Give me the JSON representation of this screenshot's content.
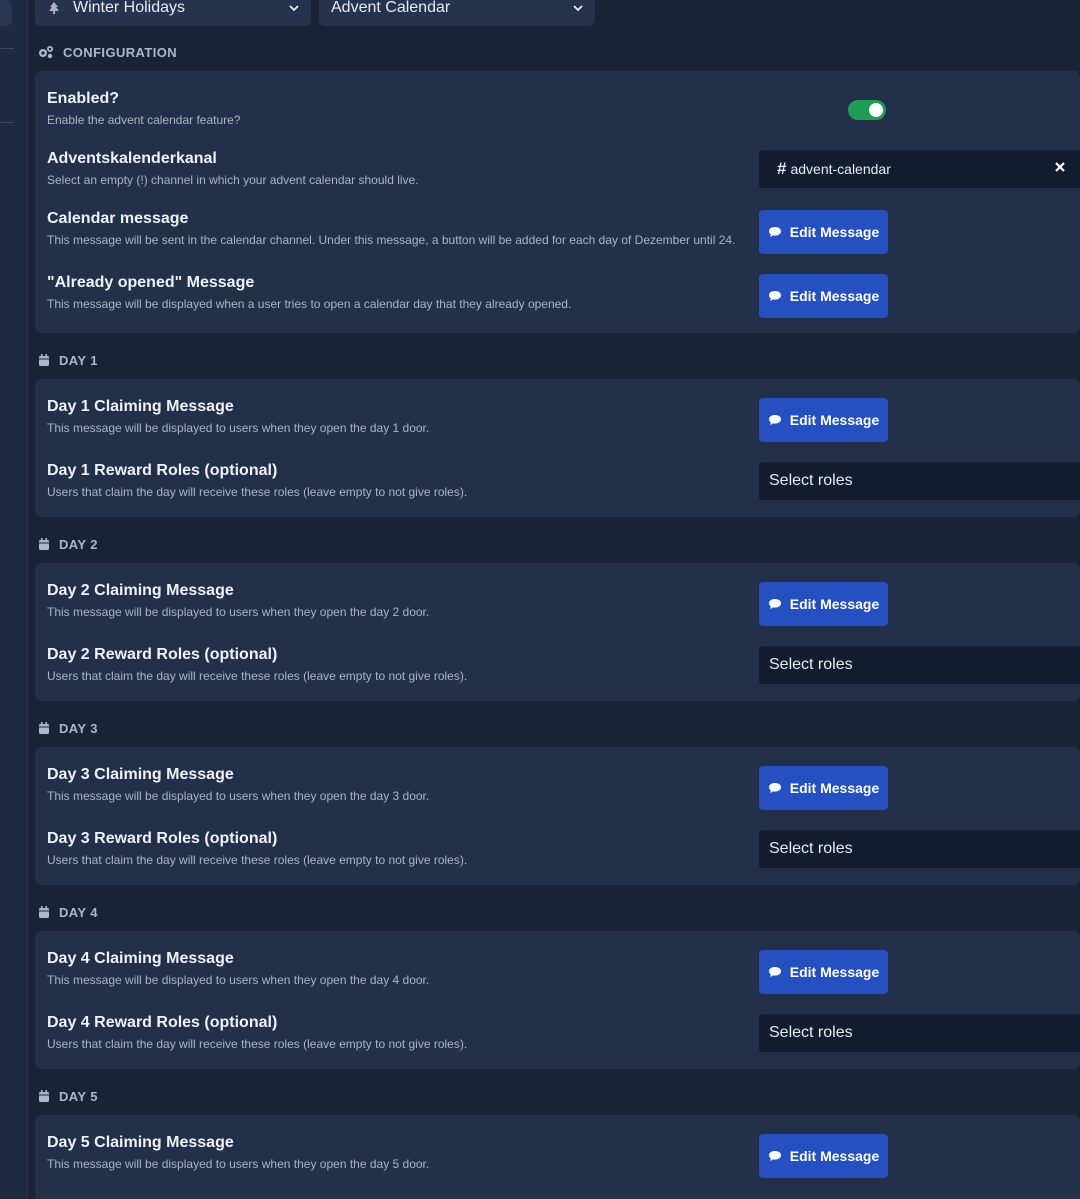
{
  "top": {
    "category_select": "Winter Holidays",
    "module_select": "Advent Calendar"
  },
  "configuration": {
    "header": "CONFIGURATION",
    "enabled": {
      "title": "Enabled?",
      "desc": "Enable the advent calendar feature?",
      "value": true
    },
    "channel": {
      "title": "Adventskalenderkanal",
      "desc": "Select an empty (!) channel in which your advent calendar should live.",
      "value": "advent-calendar"
    },
    "calendar_message": {
      "title": "Calendar message",
      "desc": "This message will be sent in the calendar channel. Under this message, a button will be added for each day of Dezember until 24."
    },
    "already_opened": {
      "title": "\"Already opened\" Message",
      "desc": "This message will be displayed when a user tries to open a calendar day that they already opened."
    }
  },
  "edit_label": "Edit Message",
  "roles_placeholder": "Select roles",
  "days": [
    {
      "header": "DAY 1",
      "claim_title": "Day 1 Claiming Message",
      "claim_desc": "This message will be displayed to users when they open the day 1 door.",
      "roles_title": "Day 1 Reward Roles (optional)",
      "roles_desc": "Users that claim the day will receive these roles (leave empty to not give roles)."
    },
    {
      "header": "DAY 2",
      "claim_title": "Day 2 Claiming Message",
      "claim_desc": "This message will be displayed to users when they open the day 2 door.",
      "roles_title": "Day 2 Reward Roles (optional)",
      "roles_desc": "Users that claim the day will receive these roles (leave empty to not give roles)."
    },
    {
      "header": "DAY 3",
      "claim_title": "Day 3 Claiming Message",
      "claim_desc": "This message will be displayed to users when they open the day 3 door.",
      "roles_title": "Day 3 Reward Roles (optional)",
      "roles_desc": "Users that claim the day will receive these roles (leave empty to not give roles)."
    },
    {
      "header": "DAY 4",
      "claim_title": "Day 4 Claiming Message",
      "claim_desc": "This message will be displayed to users when they open the day 4 door.",
      "roles_title": "Day 4 Reward Roles (optional)",
      "roles_desc": "Users that claim the day will receive these roles (leave empty to not give roles)."
    },
    {
      "header": "DAY 5",
      "claim_title": "Day 5 Claiming Message",
      "claim_desc": "This message will be displayed to users when they open the day 5 door."
    }
  ],
  "colors": {
    "background": "#1a2336",
    "card": "#22304a",
    "accent_button": "#2450c2",
    "toggle_on": "#1f9d55",
    "input_bg": "#141d2f"
  },
  "icons": {
    "configuration": "gears-icon",
    "day": "calendar-icon",
    "edit": "speech-bubble-icon",
    "category": "tree-icon"
  }
}
